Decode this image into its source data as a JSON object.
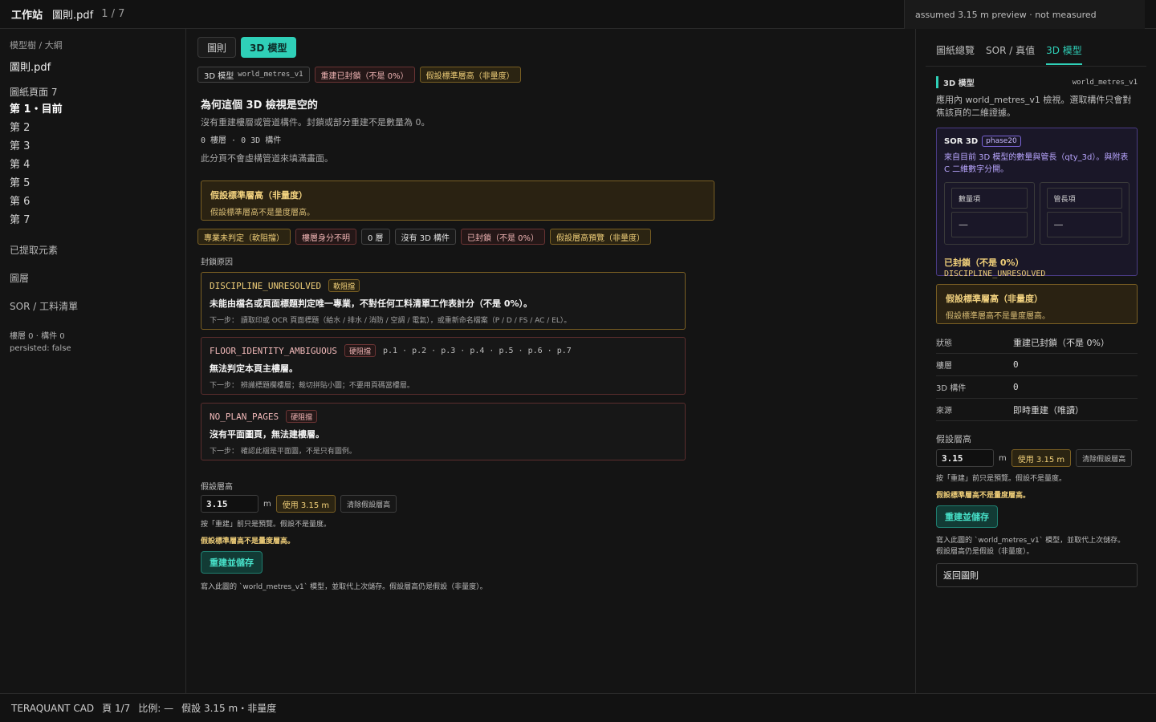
{
  "topbar": {
    "app_title": "工作站",
    "file_name": "圖則.pdf",
    "page_indicator": "1 / 7",
    "preview_note": "assumed 3.15 m preview · not measured"
  },
  "sidebar": {
    "caption": "模型樹 / 大綱",
    "file": "圖則.pdf",
    "pages_heading": "圖紙頁面 7",
    "pages": [
      "第 1・目前",
      "第 2",
      "第 3",
      "第 4",
      "第 5",
      "第 6",
      "第 7"
    ],
    "sections": [
      "已提取元素",
      "圖層",
      "SOR / 工料清單"
    ],
    "stats": {
      "line1": "樓層 0 · 構件 0",
      "line2": "persisted: false"
    }
  },
  "main": {
    "tabs": [
      {
        "label": "圖則",
        "active": false
      },
      {
        "label": "3D 模型",
        "active": true
      }
    ],
    "status_chips": {
      "model_label": "3D 模型",
      "model_value": "world_metres_v1",
      "locked": "重建已封鎖（不是 0%）",
      "assumed": "假設標準層高（非量度）"
    },
    "empty_title": "為何這個 3D 檢視是空的",
    "empty_sub": "沒有重建樓層或管道構件。封鎖或部分重建不是數量為 0。",
    "counts": "0 樓層 · 0 3D 構件",
    "no_fake": "此分頁不會虛構管道來填滿畫面。",
    "banner": {
      "title": "假設標準層高（非量度）",
      "sub": "假設標準層高不是量度層高。"
    },
    "tags": [
      {
        "text": "專業未判定（軟阻擋）",
        "tone": "amber"
      },
      {
        "text": "樓層身分不明",
        "tone": "red"
      },
      {
        "text": "0 層",
        "tone": "neutral"
      },
      {
        "text": "沒有 3D 構件",
        "tone": "neutral"
      },
      {
        "text": "已封鎖（不是 0%）",
        "tone": "red"
      },
      {
        "text": "假設層高預覽（非量度）",
        "tone": "amber"
      }
    ],
    "reasons_heading": "封鎖原因",
    "reasons": [
      {
        "code": "DISCIPLINE_UNRESOLVED",
        "badge": "軟阻擋",
        "pages": "",
        "message": "未能由檔名或頁面標題判定唯一專業，不對任何工料清單工作表計分（不是 0%）。",
        "next_label": "下一步：",
        "next": "讀取印或 OCR 頁面標題（給水 / 排水 / 消防 / 空調 / 電氣），或重新命名檔案（P / D / FS / AC / EL）。"
      },
      {
        "code": "FLOOR_IDENTITY_AMBIGUOUS",
        "badge": "硬阻擋",
        "pages": "p.1 · p.2 · p.3 · p.4 · p.5 · p.6 · p.7",
        "message": "無法判定本頁主樓層。",
        "next_label": "下一步：",
        "next": "辨識標題欄樓層；裁切拼貼小圖；不要用頁碼當樓層。"
      },
      {
        "code": "NO_PLAN_PAGES",
        "badge": "硬阻擋",
        "pages": "",
        "message": "沒有平面圖頁，無法建樓層。",
        "next_label": "下一步：",
        "next": "確認此檔是平面圖，不是只有圖例。"
      }
    ],
    "height_form": {
      "label": "假設層高",
      "value": "3.15",
      "unit": "m",
      "use_btn": "使用 3.15 m",
      "clear_btn": "清除假設層高",
      "hint": "按「重建」前只是預覽。假設不是量度。",
      "warning": "假設標準層高不是量度層高。",
      "rebuild_btn": "重建並儲存",
      "footnote": "寫入此圖的 `world_metres_v1` 模型，並取代上次儲存。假設層高仍是假設（非量度）。"
    }
  },
  "right": {
    "tabs": [
      {
        "label": "圖紙總覽",
        "active": false
      },
      {
        "label": "SOR / 真值",
        "active": false
      },
      {
        "label": "3D 模型",
        "active": true
      }
    ],
    "section_title": "3D 模型",
    "section_value": "world_metres_v1",
    "intro": "應用內 world_metres_v1 檢視。選取構件只會對焦該頁的二維證據。",
    "sor": {
      "title": "SOR 3D",
      "badge": "phase20",
      "desc": "來自目前 3D 模型的數量與管長（qty_3d）。與附表 C 二維數字分開。",
      "qty_label": "數量項",
      "qty_value": "—",
      "len_label": "管長項",
      "len_value": "—",
      "locked": "已封鎖（不是 0%）",
      "locked_code": "DISCIPLINE_UNRESOLVED"
    },
    "banner": {
      "title": "假設標準層高（非量度）",
      "sub": "假設標準層高不是量度層高。"
    },
    "kv": [
      {
        "k": "狀態",
        "v": "重建已封鎖（不是 0%）"
      },
      {
        "k": "樓層",
        "v": "0"
      },
      {
        "k": "3D 構件",
        "v": "0"
      },
      {
        "k": "來源",
        "v": "即時重建（唯讀）"
      }
    ],
    "height_form": {
      "label": "假設層高",
      "value": "3.15",
      "unit": "m",
      "use_btn": "使用 3.15 m",
      "clear_btn": "清除假設層高",
      "hint": "按「重建」前只是預覽。假設不是量度。",
      "warning": "假設標準層高不是量度層高。",
      "rebuild_btn": "重建並儲存",
      "footnote1": "寫入此圖的 `world_metres_v1` 模型，並取代上次儲存。",
      "footnote2": "假設層高仍是假設（非量度）。",
      "back_btn": "返回圖則"
    }
  },
  "footer": {
    "brand": "TERAQUANT CAD",
    "page": "頁 1/7",
    "scale": "比例: —",
    "assumed": "假設 3.15 m・非量度"
  }
}
